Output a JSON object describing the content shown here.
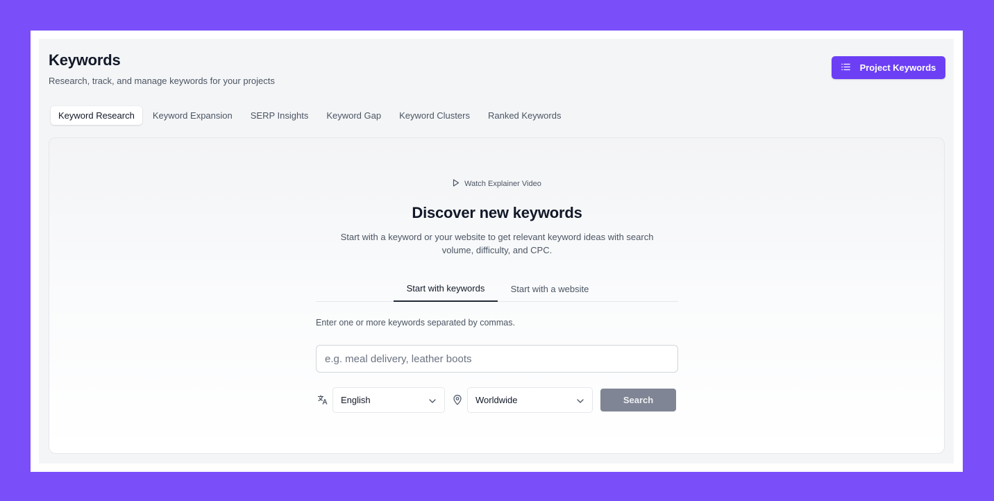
{
  "header": {
    "title": "Keywords",
    "subtitle": "Research, track, and manage keywords for your projects",
    "project_button_label": "Project Keywords",
    "project_button_icon": "list-icon"
  },
  "tabs": [
    {
      "label": "Keyword Research",
      "active": true
    },
    {
      "label": "Keyword Expansion",
      "active": false
    },
    {
      "label": "SERP Insights",
      "active": false
    },
    {
      "label": "Keyword Gap",
      "active": false
    },
    {
      "label": "Keyword Clusters",
      "active": false
    },
    {
      "label": "Ranked Keywords",
      "active": false
    }
  ],
  "research": {
    "video_link": "Watch Explainer Video",
    "title": "Discover new keywords",
    "description": "Start with a keyword or your website to get relevant keyword ideas with search volume, difficulty, and CPC.",
    "modes": [
      {
        "label": "Start with keywords",
        "active": true
      },
      {
        "label": "Start with a website",
        "active": false
      }
    ],
    "hint": "Enter one or more keywords separated by commas.",
    "input_placeholder": "e.g. meal delivery, leather boots",
    "input_value": "",
    "language": "English",
    "location": "Worldwide",
    "search_label": "Search"
  },
  "colors": {
    "accent": "#6c3ff5",
    "outer_background": "#7a4ffa",
    "search_disabled": "#7f8594"
  }
}
